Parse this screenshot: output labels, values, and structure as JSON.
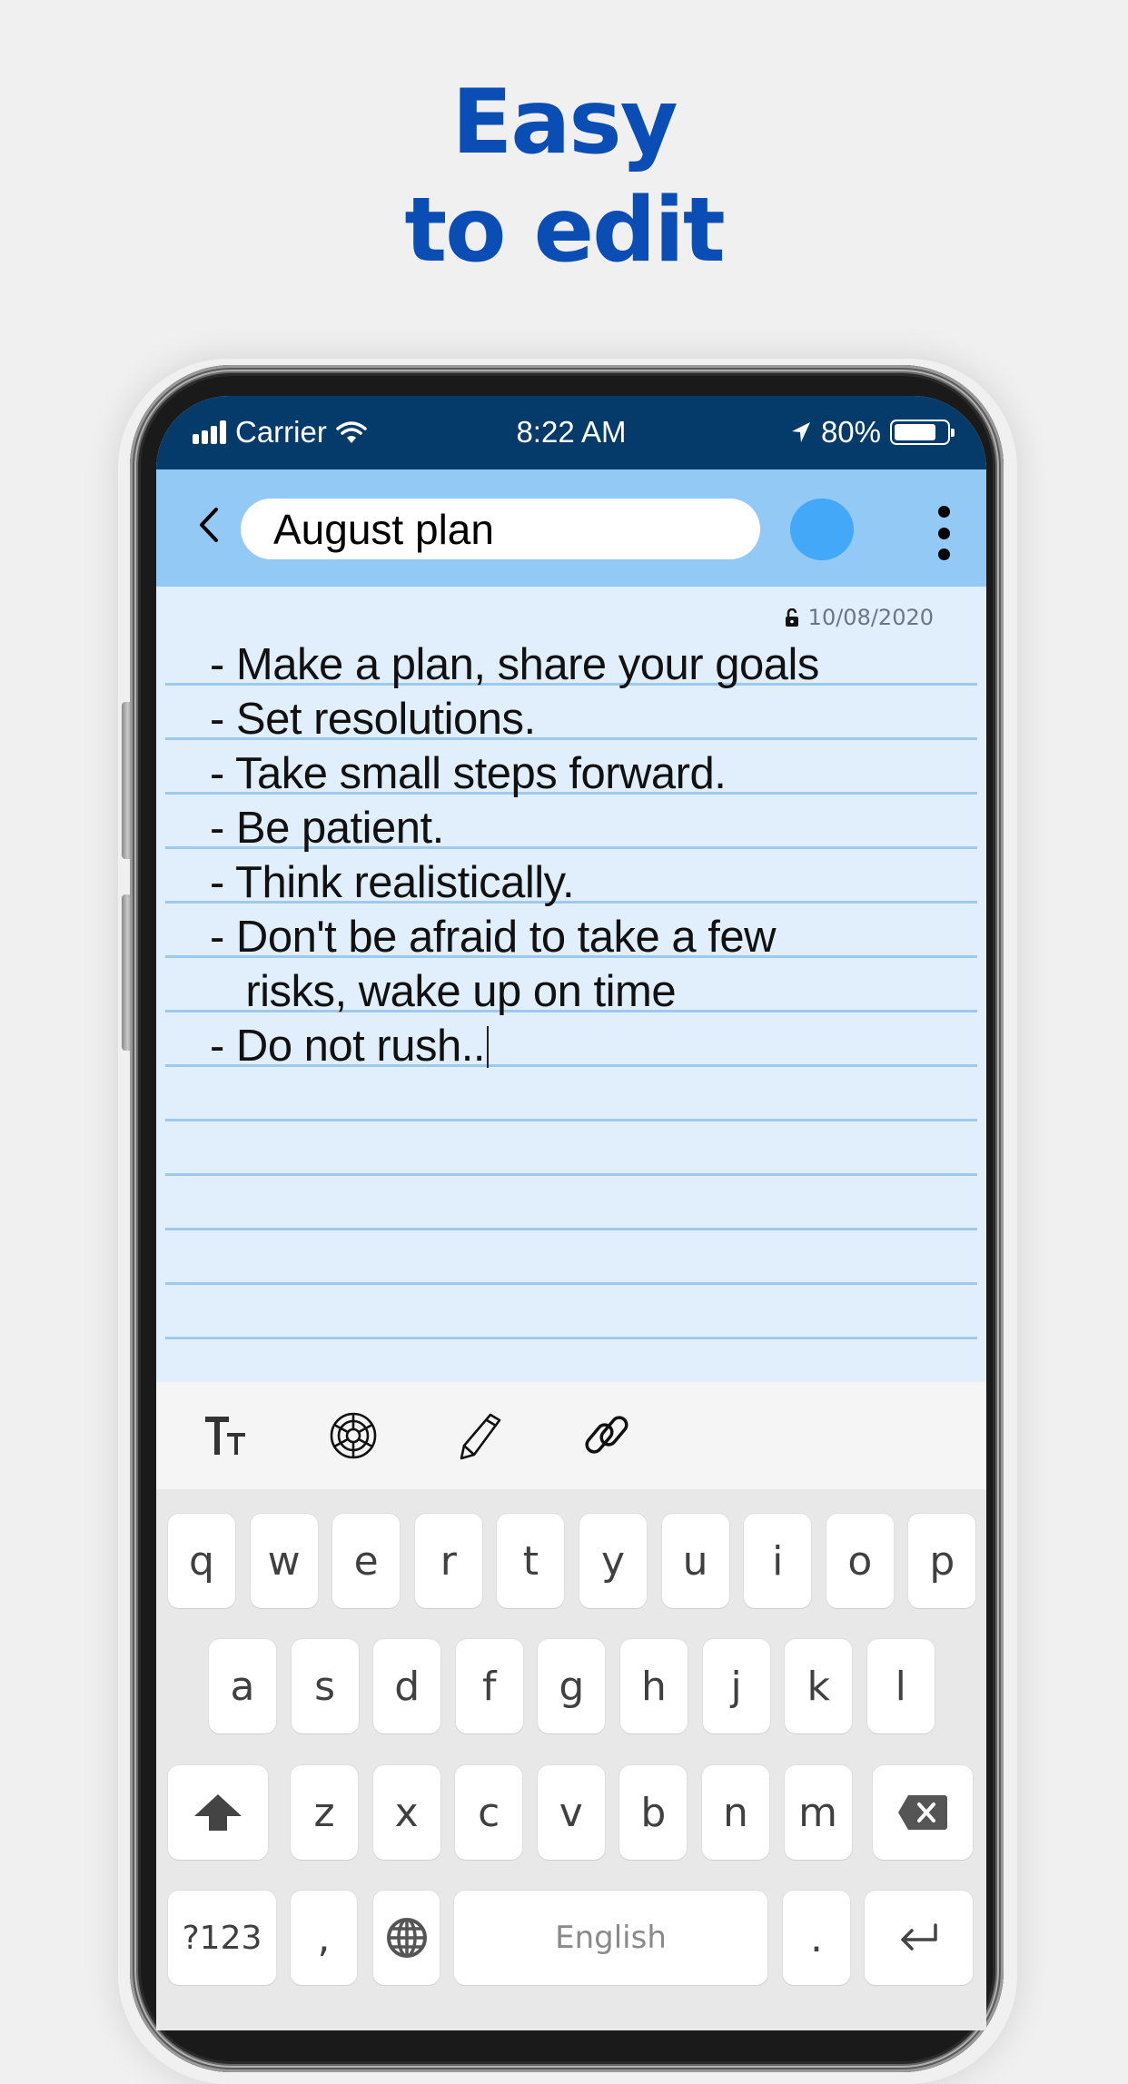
{
  "headline": {
    "line1": "Easy",
    "line2": "to edit"
  },
  "status_bar": {
    "carrier": "Carrier",
    "time": "8:22 AM",
    "battery_percent": "80%",
    "battery_level": 0.8,
    "icons": [
      "signal-icon",
      "wifi-icon",
      "location-arrow-icon",
      "battery-icon"
    ]
  },
  "header": {
    "back_icon": "chevron-left-icon",
    "title_value": "August plan",
    "color_swatch": "#42a8f7",
    "more_icon": "vertical-ellipsis-icon"
  },
  "note": {
    "lock_icon": "unlock-icon",
    "date": "10/08/2020",
    "lines": [
      "- Make a plan, share your goals",
      "- Set resolutions.",
      "- Take small steps forward.",
      "- Be patient.",
      "- Think realistically.",
      "- Don't be afraid to take a few",
      "   risks, wake up on time",
      "- Do not rush.."
    ]
  },
  "toolbar": {
    "items": [
      {
        "name": "text-size",
        "icon": "text-size-icon"
      },
      {
        "name": "color-palette",
        "icon": "color-wheel-icon"
      },
      {
        "name": "draw",
        "icon": "pencil-icon"
      },
      {
        "name": "attach-link",
        "icon": "link-icon"
      }
    ]
  },
  "keyboard": {
    "row1": [
      "q",
      "w",
      "e",
      "r",
      "t",
      "y",
      "u",
      "i",
      "o",
      "p"
    ],
    "row2": [
      "a",
      "s",
      "d",
      "f",
      "g",
      "h",
      "j",
      "k",
      "l"
    ],
    "row3": [
      "z",
      "x",
      "c",
      "v",
      "b",
      "n",
      "m"
    ],
    "symbols_label": "?123",
    "comma": ",",
    "space_label": "English",
    "period": ".",
    "icons": [
      "shift-icon",
      "backspace-icon",
      "globe-icon",
      "enter-icon"
    ]
  },
  "colors": {
    "headline": "#0a4db5",
    "status_bar": "#053b6b",
    "header": "#92c9f5",
    "note_bg": "#e1effd",
    "rule": "#9cc9ec"
  }
}
